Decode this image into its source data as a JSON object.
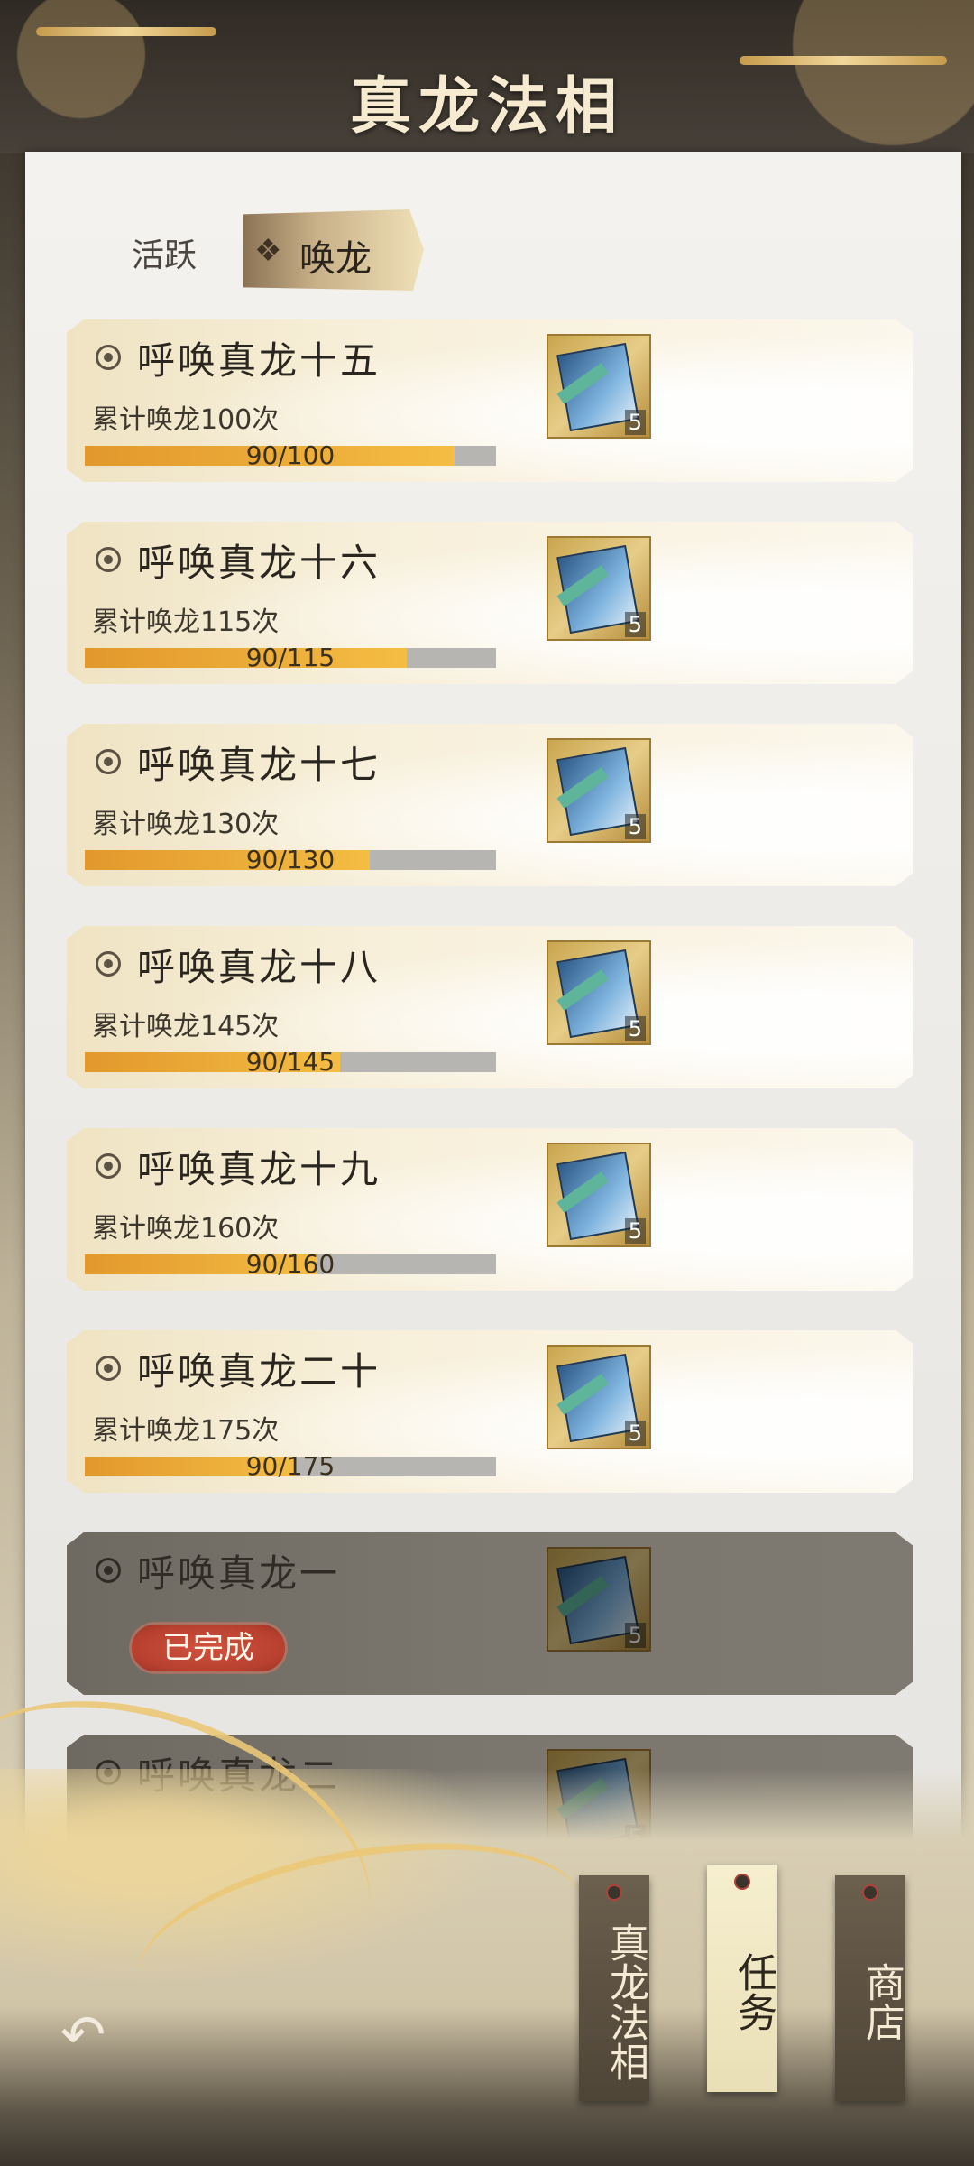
{
  "page": {
    "title": "真龙法相"
  },
  "tabs": [
    {
      "label": "活跃",
      "active": false
    },
    {
      "label": "唤龙",
      "active": true
    }
  ],
  "tasks": [
    {
      "name": "呼唤真龙十五",
      "desc": "累计唤龙100次",
      "progress_text": "90/100",
      "progress_fraction": 0.9,
      "reward_count": "5",
      "completed": false
    },
    {
      "name": "呼唤真龙十六",
      "desc": "累计唤龙115次",
      "progress_text": "90/115",
      "progress_fraction": 0.783,
      "reward_count": "5",
      "completed": false
    },
    {
      "name": "呼唤真龙十七",
      "desc": "累计唤龙130次",
      "progress_text": "90/130",
      "progress_fraction": 0.692,
      "reward_count": "5",
      "completed": false
    },
    {
      "name": "呼唤真龙十八",
      "desc": "累计唤龙145次",
      "progress_text": "90/145",
      "progress_fraction": 0.621,
      "reward_count": "5",
      "completed": false
    },
    {
      "name": "呼唤真龙十九",
      "desc": "累计唤龙160次",
      "progress_text": "90/160",
      "progress_fraction": 0.5625,
      "reward_count": "5",
      "completed": false
    },
    {
      "name": "呼唤真龙二十",
      "desc": "累计唤龙175次",
      "progress_text": "90/175",
      "progress_fraction": 0.514,
      "reward_count": "5",
      "completed": false
    },
    {
      "name": "呼唤真龙一",
      "status": "已完成",
      "reward_count": "5",
      "completed": true
    },
    {
      "name": "呼唤真龙二",
      "reward_count": "5",
      "completed": true
    }
  ],
  "bottom_nav": [
    {
      "label": "真龙法相",
      "active": false
    },
    {
      "label": "任务",
      "active": true
    },
    {
      "label": "商店",
      "active": false
    }
  ],
  "icons": {
    "back": "back-arrow-icon",
    "reward": "skill-book-icon",
    "bullet": "circle-dot-icon"
  },
  "colors": {
    "progress": "#f0b03a",
    "done_badge": "#c0463a",
    "panel": "#efedea"
  }
}
